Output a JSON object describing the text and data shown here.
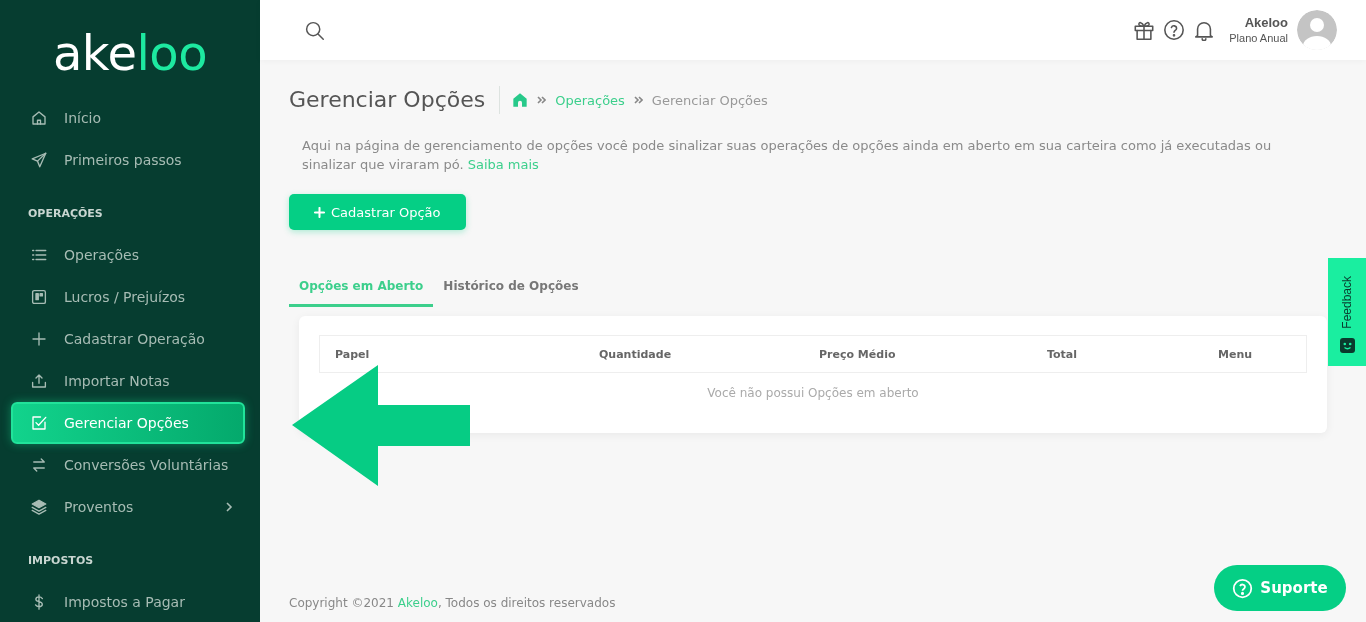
{
  "sidebar": {
    "logo": {
      "primary": "ake",
      "accent": "loo"
    },
    "sections": [
      {
        "items": [
          {
            "label": "Início",
            "selected": false,
            "expandable": false
          },
          {
            "label": "Primeiros passos",
            "selected": false,
            "expandable": false
          }
        ]
      },
      {
        "title": "OPERAÇÕES",
        "items": [
          {
            "label": "Operações",
            "selected": false,
            "expandable": false
          },
          {
            "label": "Lucros / Prejuízos",
            "selected": false,
            "expandable": false
          },
          {
            "label": "Cadastrar Operação",
            "selected": false,
            "expandable": false
          },
          {
            "label": "Importar Notas",
            "selected": false,
            "expandable": false
          },
          {
            "label": "Gerenciar Opções",
            "selected": true,
            "expandable": false
          },
          {
            "label": "Conversões Voluntárias",
            "selected": false,
            "expandable": false
          },
          {
            "label": "Proventos",
            "selected": false,
            "expandable": true
          }
        ]
      },
      {
        "title": "IMPOSTOS",
        "items": [
          {
            "label": "Impostos a Pagar",
            "selected": false,
            "expandable": false
          }
        ]
      }
    ]
  },
  "header": {
    "user": {
      "name": "Akeloo",
      "plan": "Plano Anual"
    }
  },
  "page": {
    "title": "Gerenciar Opções",
    "breadcrumb": [
      {
        "label": "Operações",
        "kind": "link"
      },
      {
        "label": "Gerenciar Opções",
        "kind": "current"
      }
    ],
    "description": "Aqui na página de gerenciamento de opções você pode sinalizar suas operações de opções ainda em aberto em sua carteira como já executadas ou sinalizar que viraram pó.",
    "description_link": "Saiba mais",
    "primary_button": "Cadastrar Opção",
    "tabs": [
      {
        "label": "Opções em Aberto",
        "selected": true
      },
      {
        "label": "Histórico de Opções",
        "selected": false
      }
    ],
    "table": {
      "columns": [
        "Papel",
        "Quantidade",
        "Preço Médio",
        "Total",
        "Menu"
      ],
      "empty_message": "Você não possui Opções em aberto"
    }
  },
  "footer": {
    "prefix": "Copyright ©2021 ",
    "link": "Akeloo",
    "suffix": ", Todos os direitos reservados"
  },
  "feedback_tab": "Feedback",
  "support_button": "Suporte"
}
